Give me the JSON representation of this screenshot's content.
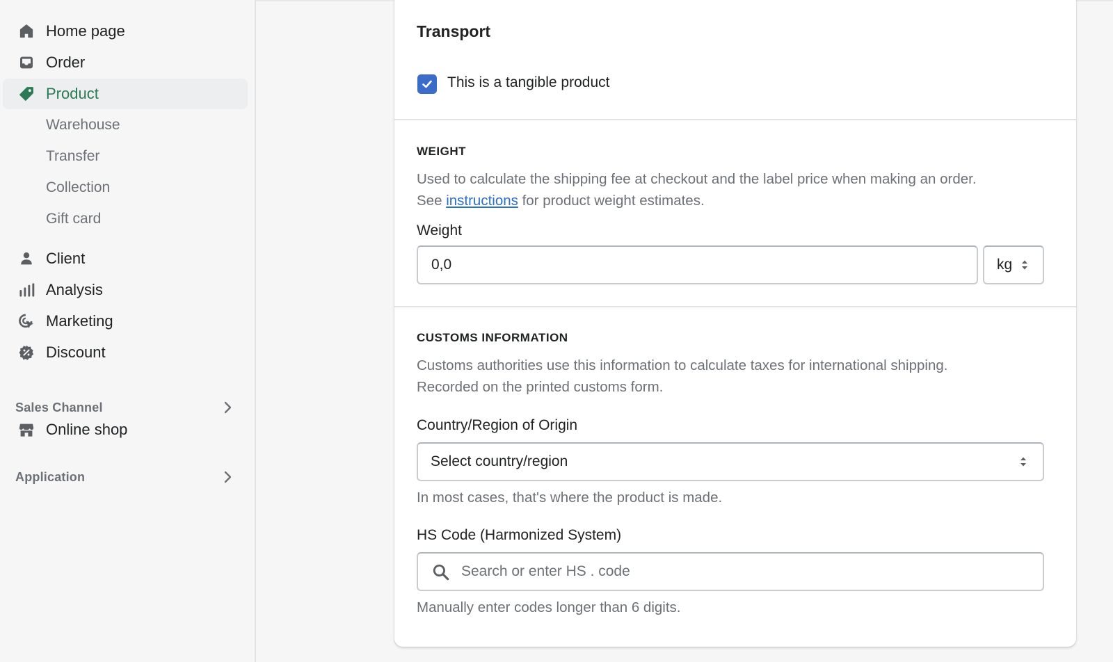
{
  "sidebar": {
    "items": [
      {
        "label": "Home page",
        "icon": "home-icon"
      },
      {
        "label": "Order",
        "icon": "inbox-icon"
      },
      {
        "label": "Product",
        "icon": "tag-icon",
        "active": true
      },
      {
        "label": "Client",
        "icon": "person-icon"
      },
      {
        "label": "Analysis",
        "icon": "bar-chart-icon"
      },
      {
        "label": "Marketing",
        "icon": "target-cursor-icon"
      },
      {
        "label": "Discount",
        "icon": "discount-badge-icon"
      }
    ],
    "product_subitems": [
      "Warehouse",
      "Transfer",
      "Collection",
      "Gift card"
    ],
    "sales_channel": {
      "label": "Sales Channel",
      "items": [
        {
          "label": "Online shop",
          "icon": "store-icon"
        }
      ]
    },
    "application": {
      "label": "Application"
    }
  },
  "card": {
    "title": "Transport",
    "tangible": {
      "label": "This is a tangible product",
      "checked": true
    },
    "weight": {
      "heading": "WEIGHT",
      "desc_line1": "Used to calculate the shipping fee at checkout and the label price when making an order.",
      "desc_see": "See",
      "desc_link": "instructions",
      "desc_rest": "for product weight estimates.",
      "field_label": "Weight",
      "value": "0,0",
      "unit": "kg"
    },
    "customs": {
      "heading": "CUSTOMS INFORMATION",
      "desc_line1": "Customs authorities use this information to calculate taxes for international shipping.",
      "desc_line2": "Recorded on the printed customs form.",
      "country_label": "Country/Region of Origin",
      "country_value": "Select country/region",
      "country_help": "In most cases, that's where the product is made.",
      "hs_label": "HS Code (Harmonized System)",
      "hs_placeholder": "Search or enter HS . code",
      "hs_help": "Manually enter codes longer than 6 digits."
    }
  },
  "colors": {
    "accent_green": "#2a7a55",
    "checkbox_blue": "#3b6cc9",
    "link_blue": "#2c6ecb"
  }
}
